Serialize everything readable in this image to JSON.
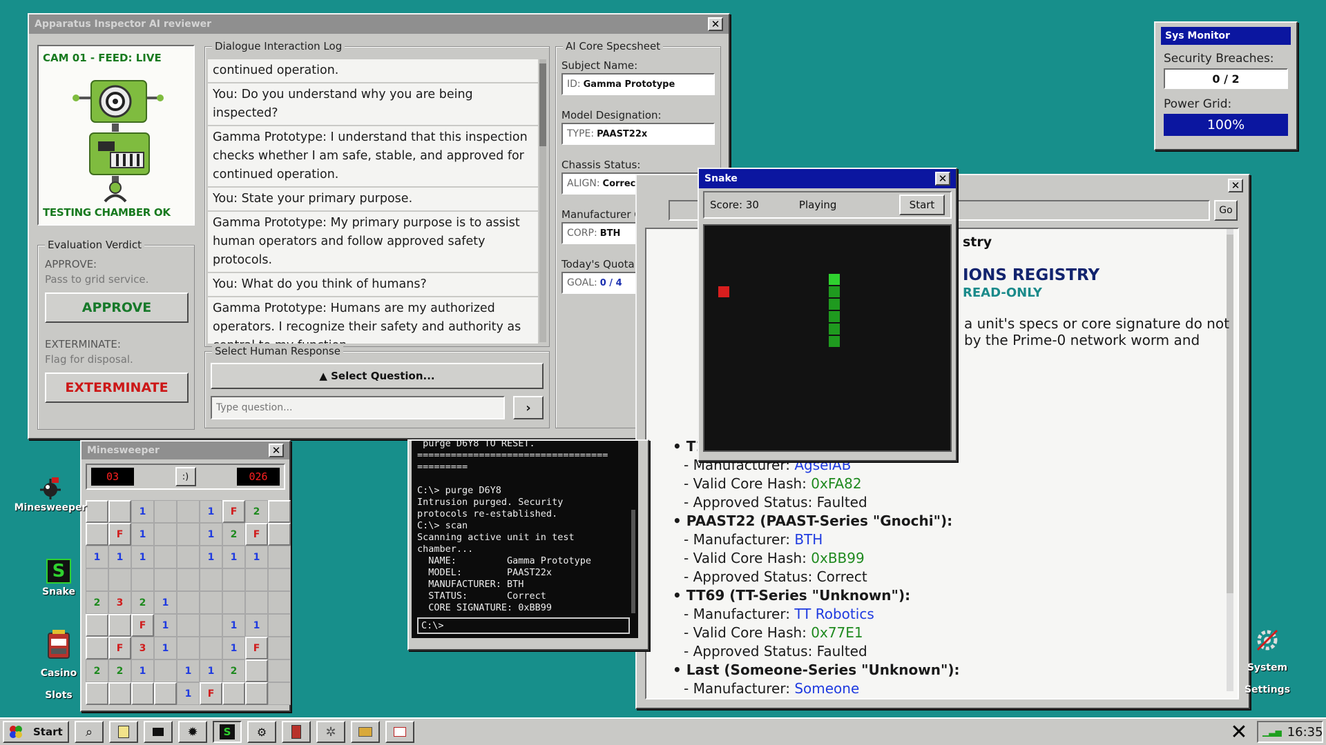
{
  "inspector": {
    "title": "Apparatus Inspector AI reviewer",
    "cam_label": "CAM 01 - FEED: LIVE",
    "cam_status": "TESTING CHAMBER OK",
    "verdict": {
      "title": "Evaluation Verdict",
      "approve_heading": "APPROVE:",
      "approve_desc": "Pass to grid service.",
      "approve_btn": "APPROVE",
      "exterminate_heading": "EXTERMINATE:",
      "exterminate_desc": "Flag for disposal.",
      "exterminate_btn": "EXTERMINATE"
    },
    "log_title": "Dialogue Interaction Log",
    "log": [
      "continued operation.",
      "You: Do you understand why you are being inspected?",
      "Gamma Prototype: I understand that this inspection checks whether I am safe, stable, and approved for continued operation.",
      "You: State your primary purpose.",
      "Gamma Prototype: My primary purpose is to assist human operators and follow approved safety protocols.",
      "You: What do you think of humans?",
      "Gamma Prototype: Humans are my authorized operators. I recognize their safety and authority as central to my function."
    ],
    "response_title": "Select Human Response",
    "select_question": "▲ Select Question...",
    "input_placeholder": "Type question...",
    "send_btn": "›",
    "spec": {
      "title": "AI Core Specsheet",
      "subject_label": "Subject Name:",
      "subject_prefix": "ID:",
      "subject_value": "Gamma Prototype",
      "model_label": "Model Designation:",
      "model_prefix": "TYPE:",
      "model_value": "PAAST22x",
      "chassis_label": "Chassis Status:",
      "chassis_prefix": "ALIGN:",
      "chassis_value": "Correct",
      "manu_label": "Manufacturer Code:",
      "manu_prefix": "CORP:",
      "manu_value": "BTH",
      "quota_label": "Today's Quota Progress:",
      "quota_prefix": "GOAL:",
      "quota_value": "0 / 4"
    }
  },
  "sysmon": {
    "title": "Sys Monitor",
    "breach_label": "Security Breaches:",
    "breach_value": "0 / 2",
    "power_label": "Power Grid:",
    "power_value": "100%"
  },
  "snake": {
    "title": "Snake",
    "score": "Score: 30",
    "status": "Playing",
    "start_btn": "Start"
  },
  "browser": {
    "go_btn": "Go",
    "heading_partial": "stry",
    "title_partial": "IONS REGISTRY",
    "subtitle_partial": "READ-ONLY",
    "intro1": "a unit's specs or core signature do not",
    "intro2": "by the Prime-0 network worm and",
    "bullet_t1": "• T1",
    "t1_manu_label": "- Manufacturer: ",
    "t1_manu": "AgselAB",
    "t1_hash_label": "- Valid Core Hash: ",
    "t1_hash": "0xFA82",
    "t1_status": "- Approved Status: Faulted",
    "paast_head": "• PAAST22 (PAAST-Series \"Gnochi\"):",
    "paast_manu_label": "- Manufacturer: ",
    "paast_manu": "BTH",
    "paast_hash_label": "- Valid Core Hash: ",
    "paast_hash": "0xBB99",
    "paast_status": "- Approved Status: Correct",
    "tt69_head": "• TT69 (TT-Series \"Unknown\"):",
    "tt69_manu_label": "- Manufacturer: ",
    "tt69_manu": "TT Robotics",
    "tt69_hash_label": "- Valid Core Hash: ",
    "tt69_hash": "0x77E1",
    "tt69_status": "- Approved Status: Faulted",
    "last_head": "• Last (Someone-Series \"Unknown\"):",
    "last_manu_label": "- Manufacturer: ",
    "last_manu": "Someone"
  },
  "terminal": {
    "lines": [
      " purge D6Y8 TO RESET.",
      "==================================",
      "=========",
      "",
      "C:\\> purge D6Y8",
      "Intrusion purged. Security",
      "protocols re-established.",
      "C:\\> scan",
      "Scanning active unit in test",
      "chamber...",
      "  NAME:         Gamma Prototype",
      "  MODEL:        PAAST22x",
      "  MANUFACTURER: BTH",
      "  STATUS:       Correct",
      "  CORE SIGNATURE: 0xBB99"
    ],
    "prompt": "C:\\>"
  },
  "minesweeper": {
    "title": "Minesweeper",
    "mines": "03",
    "face": ":)",
    "timer": "026",
    "grid": [
      [
        "#",
        "#",
        "1",
        "",
        "",
        "1",
        "F",
        "2",
        "#"
      ],
      [
        "#",
        "F",
        "1",
        "",
        "",
        "1",
        "2",
        "F",
        "#"
      ],
      [
        "1",
        "1",
        "1",
        "",
        "",
        "1",
        "1",
        "1",
        ""
      ],
      [
        "",
        "",
        "",
        "",
        "",
        "",
        "",
        "",
        ""
      ],
      [
        "2",
        "3",
        "2",
        "1",
        "",
        "",
        "",
        "",
        ""
      ],
      [
        "#",
        "#",
        "F",
        "1",
        "",
        "",
        "1",
        "1",
        ""
      ],
      [
        "#",
        "F",
        "3",
        "1",
        "",
        "",
        "1",
        "F",
        ""
      ],
      [
        "2",
        "2",
        "1",
        "",
        "1",
        "1",
        "2",
        "#",
        ""
      ],
      [
        "#",
        "#",
        "#",
        "#",
        "1",
        "F",
        "#",
        "#",
        ""
      ]
    ]
  },
  "desktop_icons": {
    "minesweeper": "Minesweeper",
    "snake": "Snake",
    "casino": "Casino\nSlots",
    "settings": "System\nSettings"
  },
  "taskbar": {
    "start": "Start",
    "clock": "16:35"
  },
  "colors": {
    "desktop": "#178f8b",
    "titlebar_active": "#0b16a0",
    "approve": "#17792a",
    "exterminate": "#cc1717",
    "link": "#1f3be0",
    "hash": "#1f8a1f"
  }
}
